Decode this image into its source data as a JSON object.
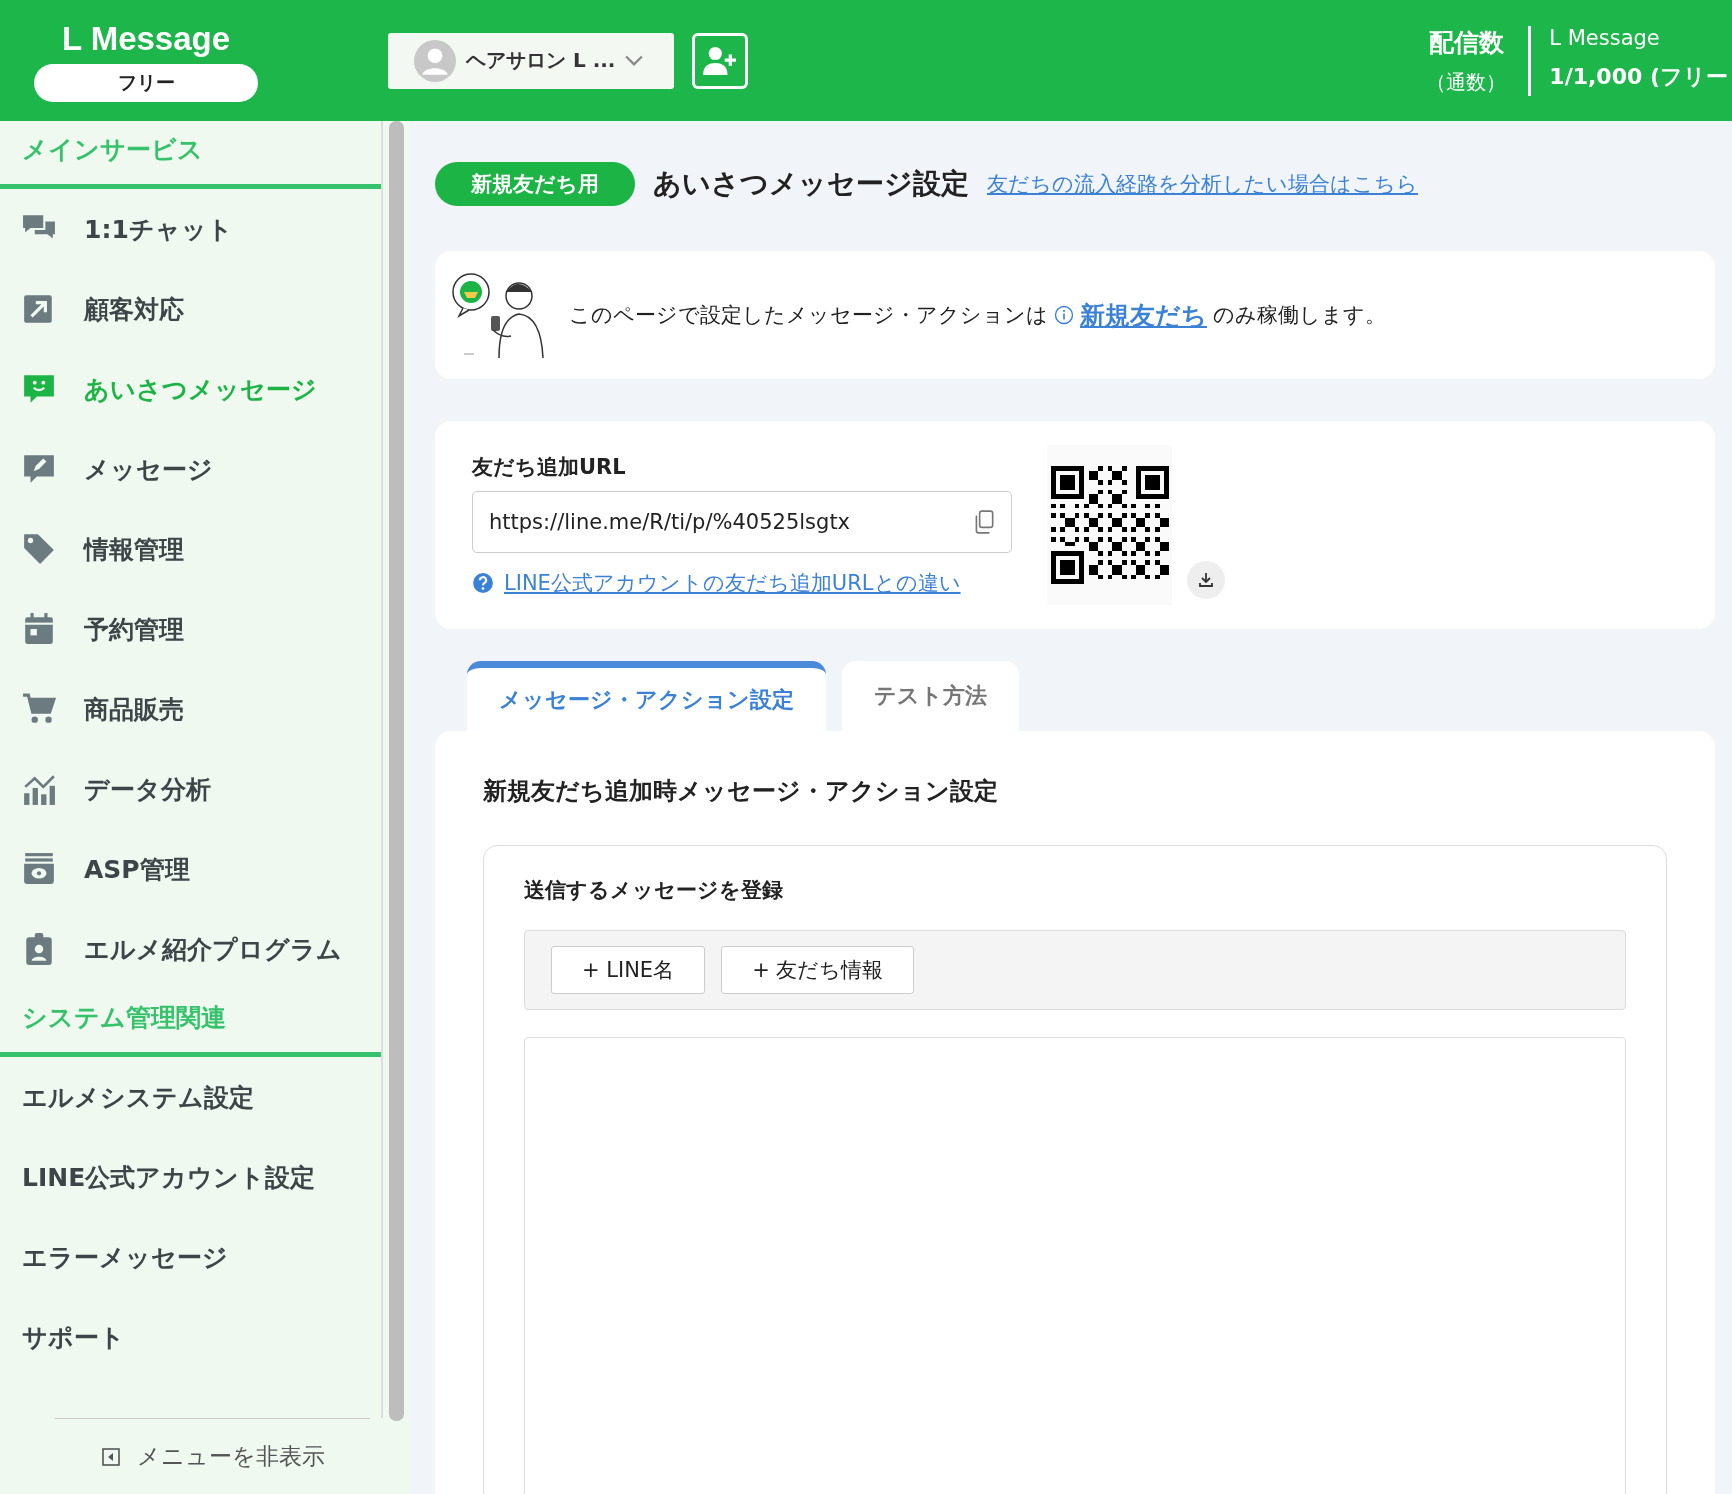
{
  "header": {
    "logo": "L Message",
    "plan": "フリー",
    "account": {
      "name": "ヘアサロン L ..."
    },
    "stats": {
      "label": "配信数",
      "unit": "（通数）",
      "service": "L Message",
      "count": "1/1,000 (フリー"
    }
  },
  "sidebar": {
    "sections": [
      {
        "title": "メインサービス",
        "items": [
          {
            "label": "1:1チャット",
            "selected": false
          },
          {
            "label": "顧客対応",
            "selected": false
          },
          {
            "label": "あいさつメッセージ",
            "selected": true
          },
          {
            "label": "メッセージ",
            "selected": false
          },
          {
            "label": "情報管理",
            "selected": false
          },
          {
            "label": "予約管理",
            "selected": false
          },
          {
            "label": "商品販売",
            "selected": false
          },
          {
            "label": "データ分析",
            "selected": false
          },
          {
            "label": "ASP管理",
            "selected": false
          },
          {
            "label": "エルメ紹介プログラム",
            "selected": false
          }
        ]
      },
      {
        "title": "システム管理関連",
        "items": [
          {
            "label": "エルメシステム設定",
            "selected": false
          },
          {
            "label": "LINE公式アカウント設定",
            "selected": false
          },
          {
            "label": "エラーメッセージ",
            "selected": false
          },
          {
            "label": "サポート",
            "selected": false
          }
        ]
      }
    ],
    "hide_menu": "メニューを非表示"
  },
  "page": {
    "badge": "新規友だち用",
    "title": "あいさつメッセージ設定",
    "analysis_link": "友だちの流入経路を分析したい場合はこちら"
  },
  "notice": {
    "before": "このページで設定したメッセージ・アクションは",
    "link": "新規友だち",
    "after": "のみ稼働します。"
  },
  "url_card": {
    "label": "友だち追加URL",
    "url": "https://line.me/R/ti/p/%40525lsgtx",
    "help_link": "LINE公式アカウントの友だち追加URLとの違い"
  },
  "tabs": [
    {
      "label": "メッセージ・アクション設定",
      "selected": true
    },
    {
      "label": "テスト方法",
      "selected": false
    }
  ],
  "panel": {
    "title": "新規友だち追加時メッセージ・アクション設定",
    "box_title": "送信するメッセージを登録",
    "insert_buttons": [
      "+ LINE名",
      "+ 友だち情報"
    ]
  }
}
